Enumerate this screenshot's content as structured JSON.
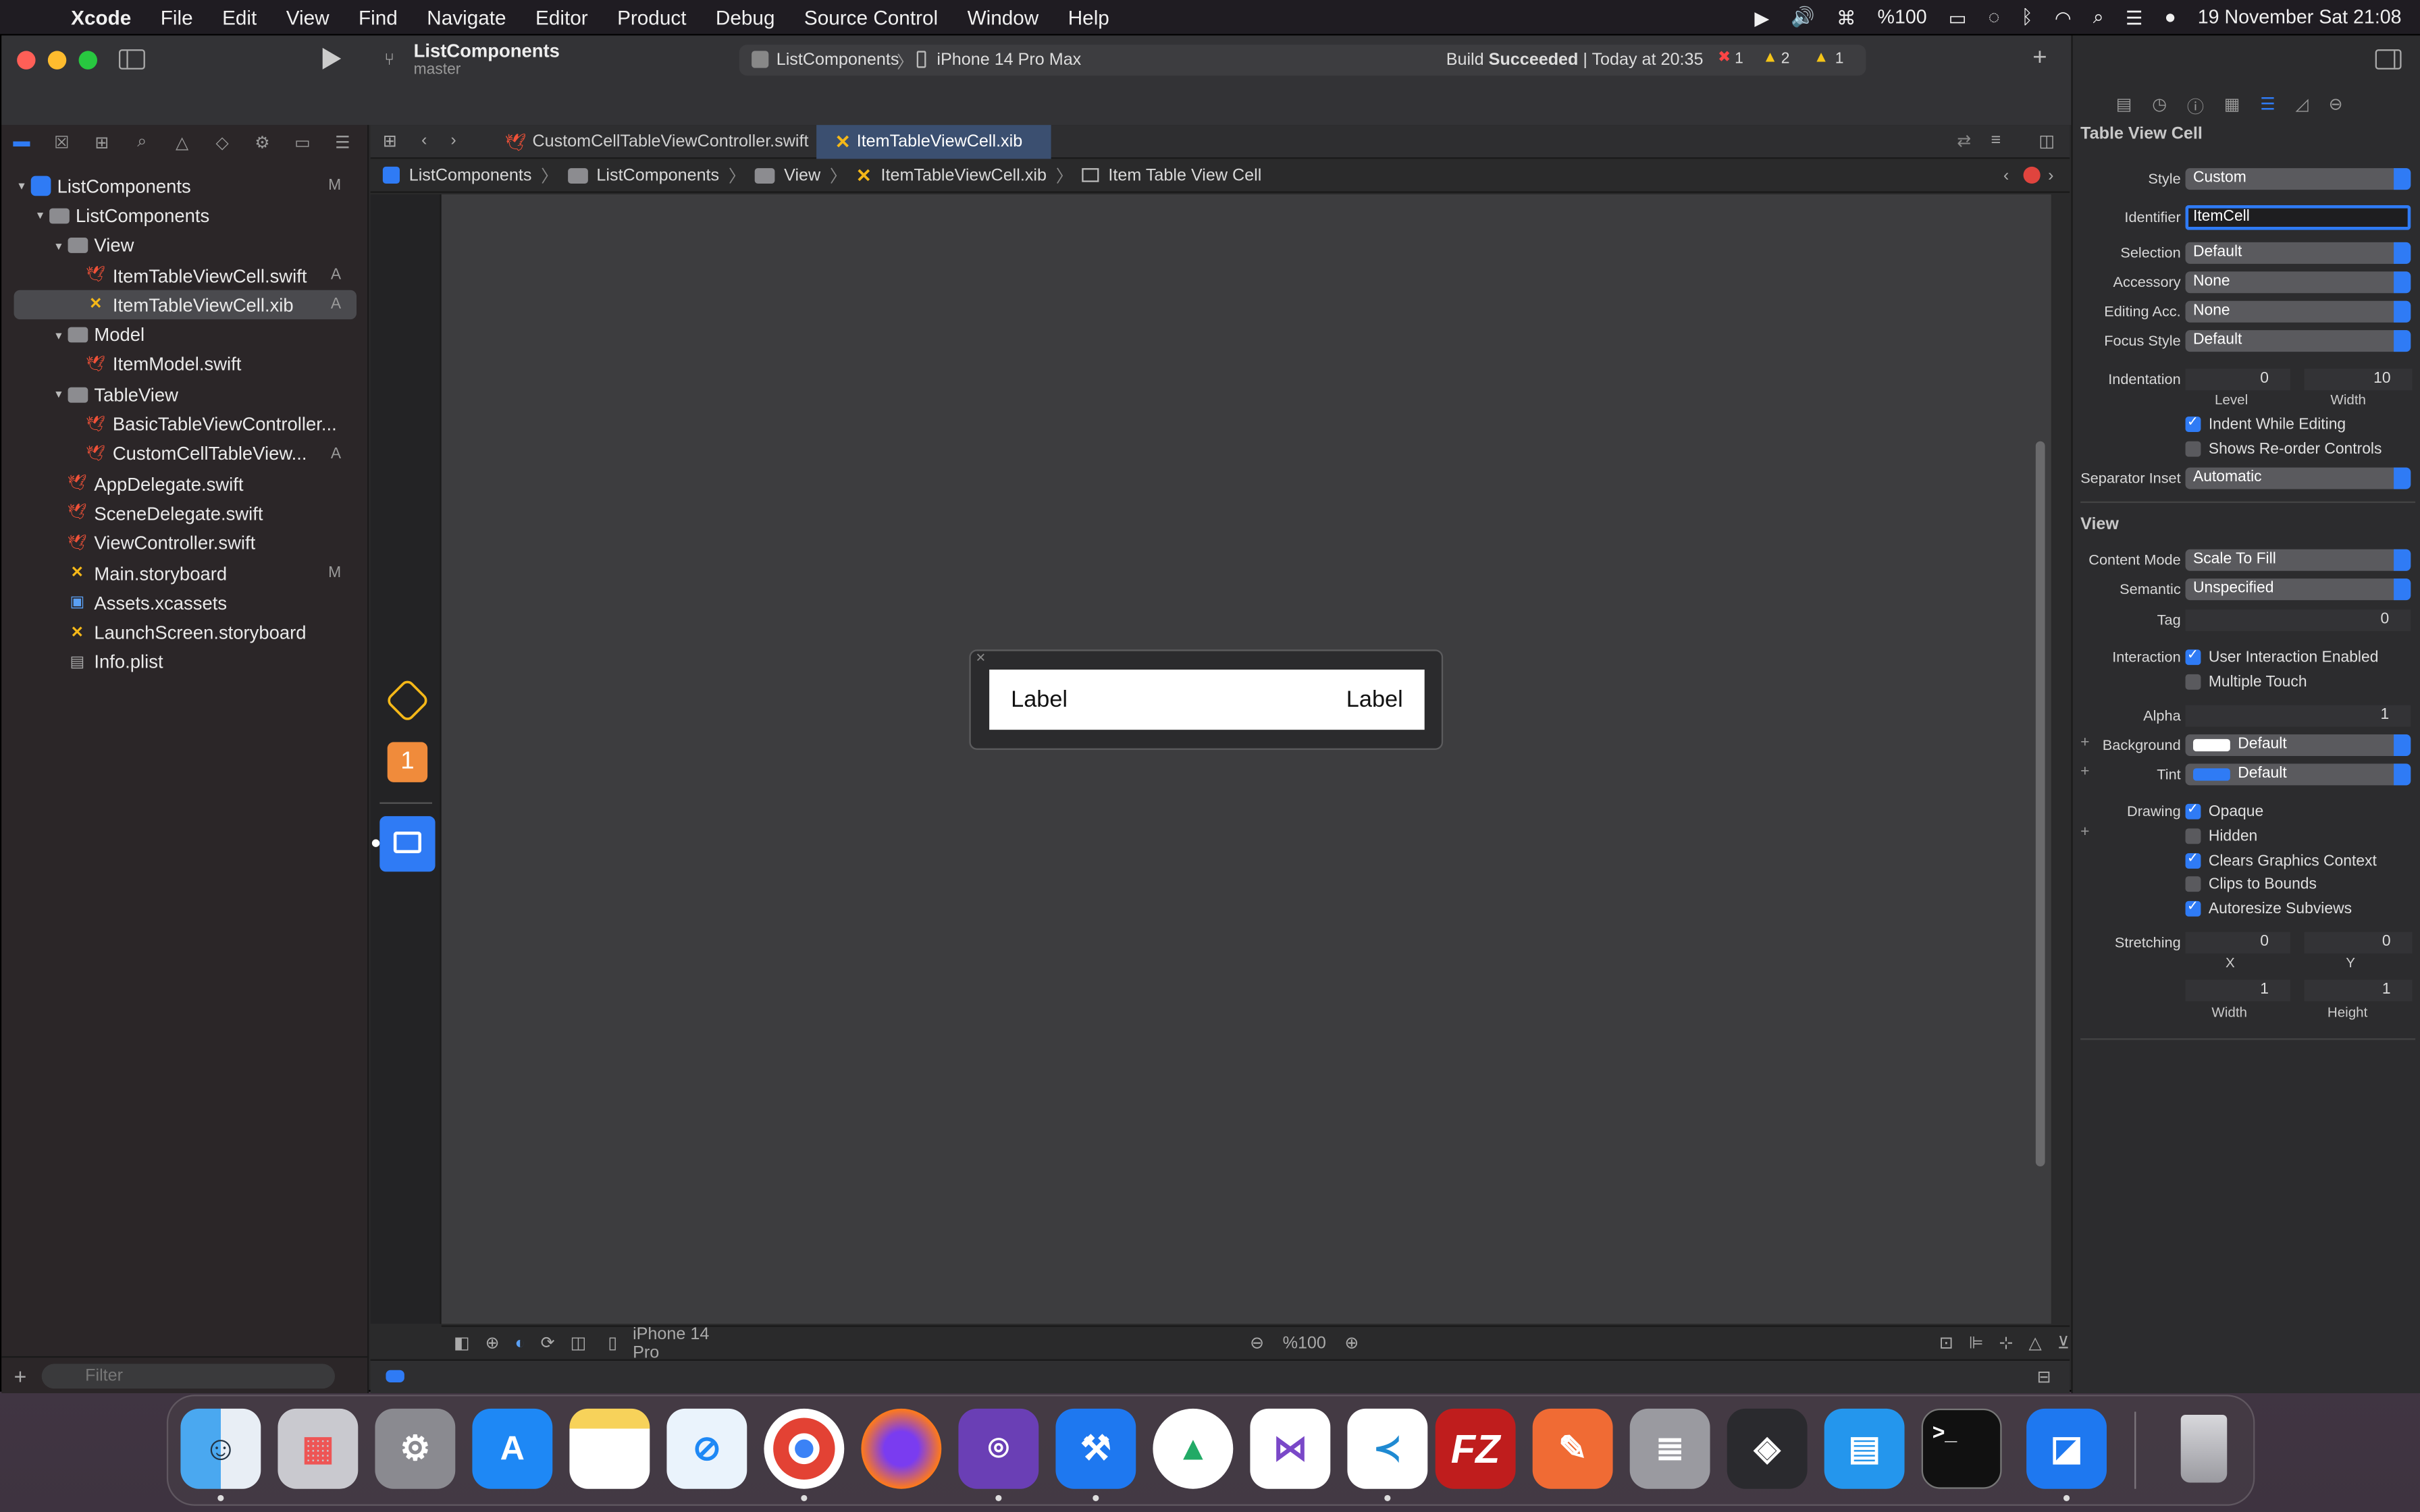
{
  "menubar": {
    "app": "Xcode",
    "items": [
      "File",
      "Edit",
      "View",
      "Find",
      "Navigate",
      "Editor",
      "Product",
      "Debug",
      "Source Control",
      "Window",
      "Help"
    ],
    "battery": "%100",
    "datetime": "19 November Sat  21:08"
  },
  "toolbar": {
    "project": "ListComponents",
    "branch": "master",
    "scheme": "ListComponents",
    "device": "iPhone 14 Pro Max",
    "status_prefix": "Build",
    "status_bold": "Succeeded",
    "status_suffix": "| Today at 20:35",
    "errors": "1",
    "warnings": "2",
    "issues": "1"
  },
  "navigator": {
    "items": [
      {
        "label": "ListComponents",
        "badge": "M"
      },
      {
        "label": "ListComponents",
        "badge": ""
      },
      {
        "label": "View",
        "badge": ""
      },
      {
        "label": "ItemTableViewCell.swift",
        "badge": "A"
      },
      {
        "label": "ItemTableViewCell.xib",
        "badge": "A"
      },
      {
        "label": "Model",
        "badge": ""
      },
      {
        "label": "ItemModel.swift",
        "badge": ""
      },
      {
        "label": "TableView",
        "badge": ""
      },
      {
        "label": "BasicTableViewController...",
        "badge": ""
      },
      {
        "label": "CustomCellTableView...",
        "badge": "A"
      },
      {
        "label": "AppDelegate.swift",
        "badge": ""
      },
      {
        "label": "SceneDelegate.swift",
        "badge": ""
      },
      {
        "label": "ViewController.swift",
        "badge": ""
      },
      {
        "label": "Main.storyboard",
        "badge": "M"
      },
      {
        "label": "Assets.xcassets",
        "badge": ""
      },
      {
        "label": "LaunchScreen.storyboard",
        "badge": ""
      },
      {
        "label": "Info.plist",
        "badge": ""
      }
    ],
    "filter_placeholder": "Filter"
  },
  "editor": {
    "tabs": [
      "CustomCellTableViewController.swift",
      "ItemTableViewCell.xib"
    ],
    "breadcrumb": [
      "ListComponents",
      "ListComponents",
      "View",
      "ItemTableViewCell.xib",
      "Item Table View Cell"
    ],
    "outline_badge": "1",
    "cell_left_label": "Label",
    "cell_right_label": "Label",
    "device_label": "iPhone 14 Pro",
    "zoom": "%100"
  },
  "inspector": {
    "title": "Table View Cell",
    "style_label": "Style",
    "style": "Custom",
    "identifier_label": "Identifier",
    "identifier": "ItemCell",
    "selection_label": "Selection",
    "selection": "Default",
    "accessory_label": "Accessory",
    "accessory": "None",
    "editing_label": "Editing Acc.",
    "editing": "None",
    "focus_label": "Focus Style",
    "focus": "Default",
    "indent_label": "Indentation",
    "indent_level": "0",
    "indent_width": "10",
    "level_sub": "Level",
    "width_sub": "Width",
    "indent_while_editing": "Indent While Editing",
    "shows_reorder": "Shows Re-order Controls",
    "separator_label": "Separator Inset",
    "separator": "Automatic",
    "view_title": "View",
    "content_mode_label": "Content Mode",
    "content_mode": "Scale To Fill",
    "semantic_label": "Semantic",
    "semantic": "Unspecified",
    "tag_label": "Tag",
    "tag": "0",
    "interaction_label": "Interaction",
    "user_interaction": "User Interaction Enabled",
    "multiple_touch": "Multiple Touch",
    "alpha_label": "Alpha",
    "alpha": "1",
    "background_label": "Background",
    "background": "Default",
    "tint_label": "Tint",
    "tint": "Default",
    "drawing_label": "Drawing",
    "opaque": "Opaque",
    "hidden": "Hidden",
    "clears": "Clears Graphics Context",
    "clips": "Clips to Bounds",
    "autoresize": "Autoresize Subviews",
    "stretching_label": "Stretching",
    "stretch_x": "0",
    "stretch_y": "0",
    "stretch_w": "1",
    "stretch_h": "1",
    "x_sub": "X",
    "y_sub": "Y",
    "w_sub": "Width",
    "h_sub": "Height"
  },
  "dock": {
    "apps": [
      "finder-icon",
      "launchpad-icon",
      "system-settings-icon",
      "app-store-icon",
      "notes-icon",
      "safari-icon",
      "chrome-icon",
      "firefox-icon",
      "github-desktop-icon",
      "xcode-icon",
      "android-studio-icon",
      "visual-studio-icon",
      "vscode-icon",
      "filezilla-icon",
      "postman-icon",
      "database-icon",
      "unity-icon",
      "docker-icon",
      "terminal-icon",
      "simulator-icon",
      "trash-icon"
    ],
    "filezilla_text": "FZ",
    "terminal_text": ">_"
  }
}
